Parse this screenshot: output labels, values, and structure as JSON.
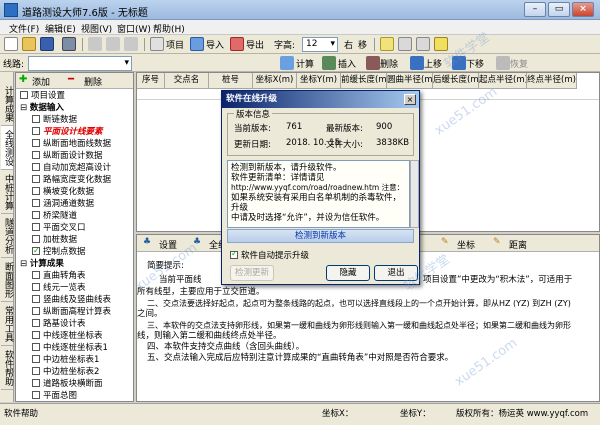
{
  "window": {
    "title": "道路测设大师7.6版 - 无标题"
  },
  "menu": [
    "文件(F)",
    "编辑(E)",
    "视图(V)",
    "窗口(W)",
    "帮助(H)"
  ],
  "toolbar1": {
    "items": [
      "项目",
      "导入",
      "导出"
    ],
    "font_label": "字高:",
    "font_value": "12",
    "extra": [
      "右",
      "移"
    ]
  },
  "toolbar2": {
    "route_label": "线路:",
    "add": "添加",
    "delete": "删除",
    "items": [
      "计算",
      "插入",
      "删除",
      "上移",
      "下移",
      "恢复"
    ]
  },
  "vertical_tabs": [
    "计算成果",
    "全线测设",
    "中桩计算",
    "隧道分析",
    "断面图形",
    "常用工具",
    "软件帮助"
  ],
  "tree": [
    {
      "label": "项目设置",
      "level": 0,
      "check": "none"
    },
    {
      "label": "数据输入",
      "level": 0,
      "check": "none",
      "group": true
    },
    {
      "label": "断链数据",
      "level": 1,
      "check": "box"
    },
    {
      "label": "平面设计线要素",
      "level": 1,
      "check": "box",
      "highlight": true
    },
    {
      "label": "纵断面地面线数据",
      "level": 1,
      "check": "box"
    },
    {
      "label": "纵断面设计数据",
      "level": 1,
      "check": "box"
    },
    {
      "label": "自动加宽超高设计",
      "level": 1,
      "check": "box"
    },
    {
      "label": "路幅宽度变化数据",
      "level": 1,
      "check": "box"
    },
    {
      "label": "横坡变化数据",
      "level": 1,
      "check": "box"
    },
    {
      "label": "涵洞通道数据",
      "level": 1,
      "check": "box"
    },
    {
      "label": "桥梁隧道",
      "level": 1,
      "check": "box"
    },
    {
      "label": "平面交叉口",
      "level": 1,
      "check": "box"
    },
    {
      "label": "加桩数据",
      "level": 1,
      "check": "box"
    },
    {
      "label": "控制点数据",
      "level": 1,
      "check": "checked"
    },
    {
      "label": "计算成果",
      "level": 0,
      "check": "none",
      "group": true
    },
    {
      "label": "直曲转角表",
      "level": 1,
      "check": "box"
    },
    {
      "label": "线元一览表",
      "level": 1,
      "check": "box"
    },
    {
      "label": "竖曲线及竖曲线表",
      "level": 1,
      "check": "box"
    },
    {
      "label": "纵断面高程计算表",
      "level": 1,
      "check": "box"
    },
    {
      "label": "路基设计表",
      "level": 1,
      "check": "box"
    },
    {
      "label": "中线逐桩坐标表",
      "level": 1,
      "check": "box"
    },
    {
      "label": "中线逐桩坐标表1",
      "level": 1,
      "check": "box"
    },
    {
      "label": "中边桩坐标表1",
      "level": 1,
      "check": "box"
    },
    {
      "label": "中边桩坐标表2",
      "level": 1,
      "check": "box"
    },
    {
      "label": "道路板块横断面",
      "level": 1,
      "check": "box"
    },
    {
      "label": "平面总图",
      "level": 1,
      "check": "box"
    }
  ],
  "grid": {
    "columns": [
      "序号",
      "交点名",
      "桩号",
      "坐标X(m)",
      "坐标Y(m)",
      "前缓长度(m)",
      "圆曲半径(m)",
      "后缓长度(m)",
      "起点半径(m)",
      "终点半径(m)"
    ]
  },
  "bottom_toolbar": {
    "items": [
      "设置",
      "全线",
      "坐标",
      "距离"
    ]
  },
  "help": {
    "heading": "简要提示:",
    "lines": [
      "一、当前平面线...",
      "所有线型，主要应用于立交匝道。",
      "二、交点法要选择好起点，起点可为整条线路的起点，也可以选择直线段上的一个点开始计算，即从HZ (YZ) 到ZH (ZY)",
      "之间。",
      "三、本软件的交点法支持卵形线，如果第一缓和曲线为卵形线则输入第一缓和曲线起点处半径；如果第二缓和曲线为卵形",
      "线，则输入第二缓和曲线终点处半径。",
      "四、本软件支持交点曲线（含回头曲线）。",
      "五、交点法输入完成后应特别注意计算成果的“直曲转角表”中对照是否符合要求。"
    ],
    "right_fragment": "项目设置”中更改为“积木法”，可适用于",
    "mid_fragment": "当前平面线"
  },
  "status": {
    "left": "软件帮助",
    "x_label": "坐标X：",
    "y_label": "坐标Y：",
    "copyright": "版权所有：杨运英 www.yyqf.com"
  },
  "dialog": {
    "title": "软件在线升级",
    "close": "×",
    "info_legend": "版本信息",
    "current_label": "当前版本:",
    "current_value": "761",
    "latest_label": "最新版本:",
    "latest_value": "900",
    "date_label": "更新日期:",
    "date_value": "2018. 10. 15",
    "size_label": "文件大小:",
    "size_value": "3838KB",
    "memo": [
      "检测到新版本，请升级软件。",
      "软件更新清单：详情请见",
      "http://www.yyqf.com/road/roadnew.htm 注意：",
      "如果系统安装有采用白名单机制的杀毒软件，升级",
      "中请及时选择“允许”，并设为信任软件。"
    ],
    "link": "检测到新版本",
    "auto_check": "软件自动提示升级",
    "buttons": {
      "check": "检测更新",
      "hide": "隐藏",
      "exit": "退出"
    }
  },
  "watermarks": [
    "xue51.com",
    "软件学堂",
    "xue51.com",
    "软件学堂",
    "xue51.com"
  ]
}
